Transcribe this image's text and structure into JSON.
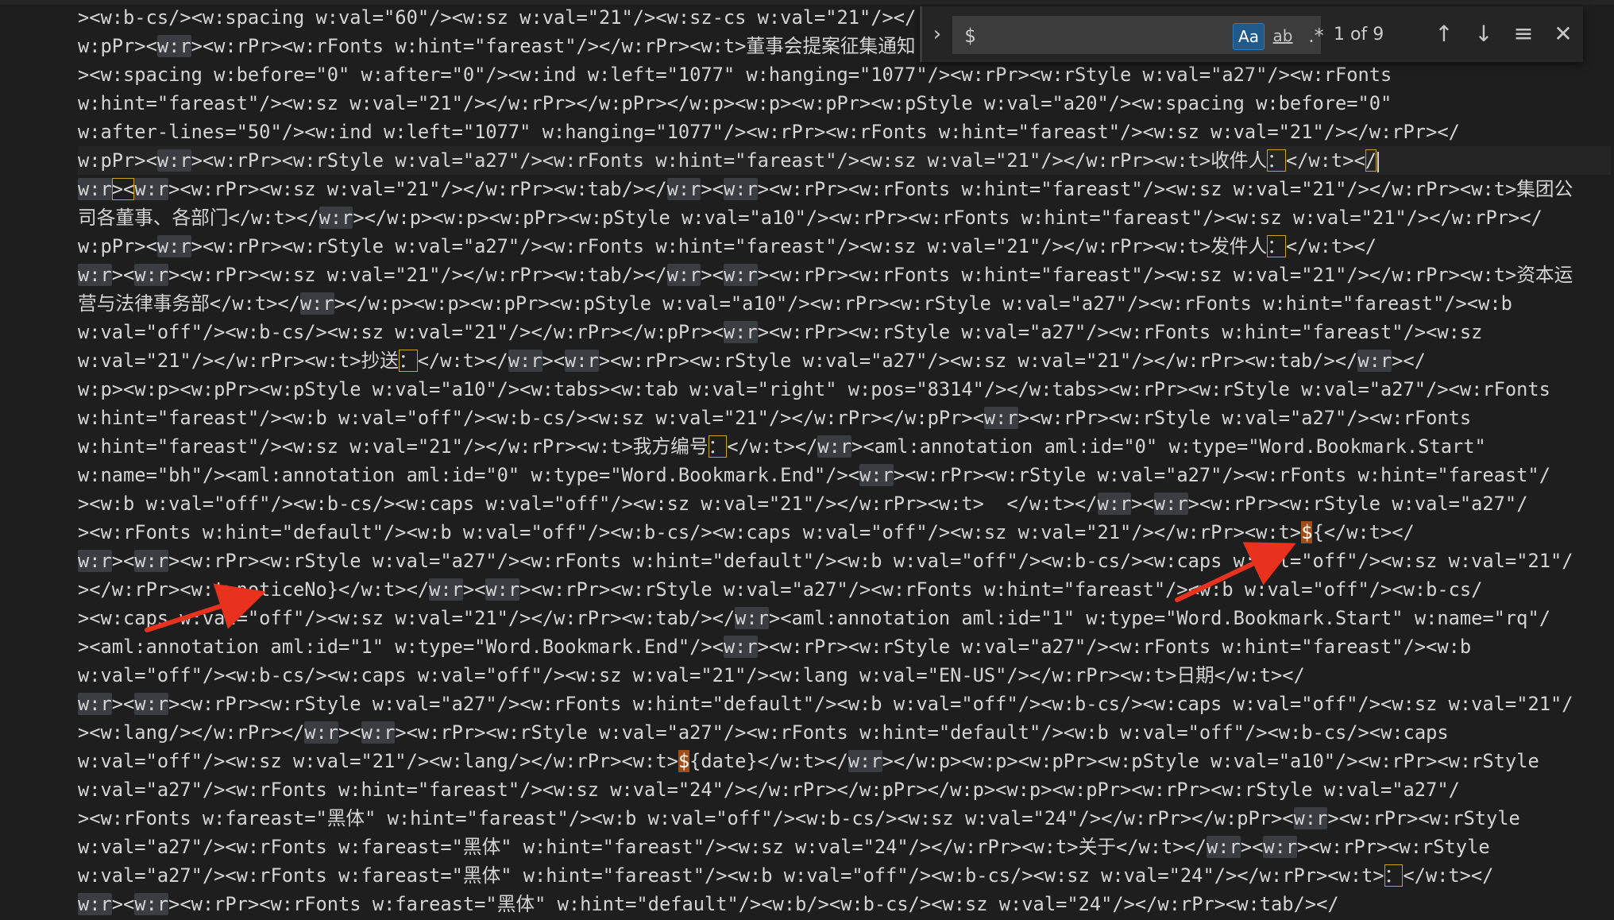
{
  "editor": {
    "lines": [
      [
        [
          "><w:b-cs/><w:spacing w:val=\"60\"/><w:sz w:val=\"21\"/><w:sz-cs w:val=\"21\"/></"
        ]
      ],
      [
        [
          "w:pPr><"
        ],
        [
          "w:r",
          "hl"
        ],
        [
          "><w:rPr><w:rFonts w:hint=\"fareast\"/></w:rPr><w:t>董事会提案征集通知"
        ]
      ],
      [
        [
          "><w:spacing w:before=\"0\" w:after=\"0\"/><w:ind w:left=\"1077\" w:hanging=\"1077\"/><w:rPr><w:rStyle w:val=\"a27\"/><w:rFonts"
        ]
      ],
      [
        [
          "w:hint=\"fareast\"/><w:sz w:val=\"21\"/></w:rPr></w:pPr></w:p><w:p><w:pPr><w:pStyle w:val=\"a20\"/><w:spacing w:before=\"0\""
        ]
      ],
      [
        [
          "w:after-lines=\"50\"/><w:ind w:left=\"1077\" w:hanging=\"1077\"/><w:rPr><w:rFonts w:hint=\"fareast\"/><w:sz w:val=\"21\"/></w:rPr></"
        ]
      ],
      [
        [
          "w:pPr><"
        ],
        [
          "w:r",
          "hl"
        ],
        [
          "><w:rPr><w:rStyle w:val=\"a27\"/><w:rFonts w:hint=\"fareast\"/><w:sz w:val=\"21\"/></w:rPr><w:t>收件人"
        ],
        [
          "：",
          "box"
        ],
        [
          "</w:t><"
        ],
        [
          "/",
          "box"
        ],
        [
          "",
          "caret"
        ]
      ],
      [
        [
          "w:r",
          "hl"
        ],
        [
          "><",
          "box"
        ],
        [
          "w:r",
          "hl"
        ],
        [
          "><w:rPr><w:sz w:val=\"21\"/></w:rPr><w:tab/></"
        ],
        [
          "w:r",
          "hl"
        ],
        [
          "><"
        ],
        [
          "w:r",
          "hl"
        ],
        [
          "><w:rPr><w:rFonts w:hint=\"fareast\"/><w:sz w:val=\"21\"/></w:rPr><w:t>集团公"
        ]
      ],
      [
        [
          "司各董事、各部门</w:t></"
        ],
        [
          "w:r",
          "hl"
        ],
        [
          "></w:p><w:p><w:pPr><w:pStyle w:val=\"a10\"/><w:rPr><w:rFonts w:hint=\"fareast\"/><w:sz w:val=\"21\"/></w:rPr></"
        ]
      ],
      [
        [
          "w:pPr><"
        ],
        [
          "w:r",
          "hl"
        ],
        [
          "><w:rPr><w:rStyle w:val=\"a27\"/><w:rFonts w:hint=\"fareast\"/><w:sz w:val=\"21\"/></w:rPr><w:t>发件人"
        ],
        [
          "：",
          "box"
        ],
        [
          "</w:t></"
        ]
      ],
      [
        [
          "w:r",
          "hl"
        ],
        [
          "><"
        ],
        [
          "w:r",
          "hl"
        ],
        [
          "><w:rPr><w:sz w:val=\"21\"/></w:rPr><w:tab/></"
        ],
        [
          "w:r",
          "hl"
        ],
        [
          "><"
        ],
        [
          "w:r",
          "hl"
        ],
        [
          "><w:rPr><w:rFonts w:hint=\"fareast\"/><w:sz w:val=\"21\"/></w:rPr><w:t>资本运"
        ]
      ],
      [
        [
          "营与法律事务部</w:t></"
        ],
        [
          "w:r",
          "hl"
        ],
        [
          "></w:p><w:p><w:pPr><w:pStyle w:val=\"a10\"/><w:rPr><w:rStyle w:val=\"a27\"/><w:rFonts w:hint=\"fareast\"/><w:b"
        ]
      ],
      [
        [
          "w:val=\"off\"/><w:b-cs/><w:sz w:val=\"21\"/></w:rPr></w:pPr><"
        ],
        [
          "w:r",
          "hl"
        ],
        [
          "><w:rPr><w:rStyle w:val=\"a27\"/><w:rFonts w:hint=\"fareast\"/><w:sz"
        ]
      ],
      [
        [
          "w:val=\"21\"/></w:rPr><w:t>抄送"
        ],
        [
          "：",
          "box"
        ],
        [
          "</w:t></"
        ],
        [
          "w:r",
          "hl"
        ],
        [
          "><"
        ],
        [
          "w:r",
          "hl"
        ],
        [
          "><w:rPr><w:rStyle w:val=\"a27\"/><w:sz w:val=\"21\"/></w:rPr><w:tab/></"
        ],
        [
          "w:r",
          "hl"
        ],
        [
          "></"
        ]
      ],
      [
        [
          "w:p><w:p><w:pPr><w:pStyle w:val=\"a10\"/><w:tabs><w:tab w:val=\"right\" w:pos=\"8314\"/></w:tabs><w:rPr><w:rStyle w:val=\"a27\"/><w:rFonts"
        ]
      ],
      [
        [
          "w:hint=\"fareast\"/><w:b w:val=\"off\"/><w:b-cs/><w:sz w:val=\"21\"/></w:rPr></w:pPr><"
        ],
        [
          "w:r",
          "hl"
        ],
        [
          "><w:rPr><w:rStyle w:val=\"a27\"/><w:rFonts"
        ]
      ],
      [
        [
          "w:hint=\"fareast\"/><w:sz w:val=\"21\"/></w:rPr><w:t>我方编号"
        ],
        [
          "：",
          "box"
        ],
        [
          "</w:t></"
        ],
        [
          "w:r",
          "hl"
        ],
        [
          "><aml:annotation aml:id=\"0\" w:type=\"Word.Bookmark.Start\""
        ]
      ],
      [
        [
          "w:name=\"bh\"/><aml:annotation aml:id=\"0\" w:type=\"Word.Bookmark.End\"/><"
        ],
        [
          "w:r",
          "hl"
        ],
        [
          "><w:rPr><w:rStyle w:val=\"a27\"/><w:rFonts w:hint=\"fareast\"/"
        ]
      ],
      [
        [
          "><w:b w:val=\"off\"/><w:b-cs/><w:caps w:val=\"off\"/><w:sz w:val=\"21\"/></w:rPr><w:t>  </w:t></"
        ],
        [
          "w:r",
          "hl"
        ],
        [
          "><"
        ],
        [
          "w:r",
          "hl"
        ],
        [
          "><w:rPr><w:rStyle w:val=\"a27\"/"
        ]
      ],
      [
        [
          "><w:rFonts w:hint=\"default\"/><w:b w:val=\"off\"/><w:b-cs/><w:caps w:val=\"off\"/><w:sz w:val=\"21\"/></w:rPr><w:t>"
        ],
        [
          "$",
          "cur"
        ],
        [
          "{</w:t></"
        ]
      ],
      [
        [
          "w:r",
          "hl"
        ],
        [
          "><"
        ],
        [
          "w:r",
          "hl"
        ],
        [
          "><w:rPr><w:rStyle w:val=\"a27\"/><w:rFonts w:hint=\"default\"/><w:b w:val=\"off\"/><w:b-cs/><w:caps w:val=\"off\"/><w:sz w:val=\"21\"/"
        ]
      ],
      [
        [
          "></w:rPr><w:t>noticeNo}</w:t></"
        ],
        [
          "w:r",
          "hl"
        ],
        [
          "><"
        ],
        [
          "w:r",
          "hl"
        ],
        [
          "><w:rPr><w:rStyle w:val=\"a27\"/><w:rFonts w:hint=\"fareast\"/><w:b w:val=\"off\"/><w:b-cs/"
        ]
      ],
      [
        [
          "><w:caps w:val=\"off\"/><w:sz w:val=\"21\"/></w:rPr><w:tab/></"
        ],
        [
          "w:r",
          "hl"
        ],
        [
          "><aml:annotation aml:id=\"1\" w:type=\"Word.Bookmark.Start\" w:name=\"rq\"/"
        ]
      ],
      [
        [
          "><aml:annotation aml:id=\"1\" w:type=\"Word.Bookmark.End\"/><"
        ],
        [
          "w:r",
          "hl"
        ],
        [
          "><w:rPr><w:rStyle w:val=\"a27\"/><w:rFonts w:hint=\"fareast\"/><w:b"
        ]
      ],
      [
        [
          "w:val=\"off\"/><w:b-cs/><w:caps w:val=\"off\"/><w:sz w:val=\"21\"/><w:lang w:val=\"EN-US\"/></w:rPr><w:t>日期</w:t></"
        ]
      ],
      [
        [
          "w:r",
          "hl"
        ],
        [
          "><"
        ],
        [
          "w:r",
          "hl"
        ],
        [
          "><w:rPr><w:rStyle w:val=\"a27\"/><w:rFonts w:hint=\"default\"/><w:b w:val=\"off\"/><w:b-cs/><w:caps w:val=\"off\"/><w:sz w:val=\"21\"/"
        ]
      ],
      [
        [
          "><w:lang/></w:rPr></"
        ],
        [
          "w:r",
          "hl"
        ],
        [
          "><"
        ],
        [
          "w:r",
          "hl"
        ],
        [
          "><w:rPr><w:rStyle w:val=\"a27\"/><w:rFonts w:hint=\"default\"/><w:b w:val=\"off\"/><w:b-cs/><w:caps"
        ]
      ],
      [
        [
          "w:val=\"off\"/><w:sz w:val=\"21\"/><w:lang/></w:rPr><w:t>"
        ],
        [
          "$",
          "cur"
        ],
        [
          "{date}</w:t></"
        ],
        [
          "w:r",
          "hl"
        ],
        [
          "></w:p><w:p><w:pPr><w:pStyle w:val=\"a10\"/><w:rPr><w:rStyle"
        ]
      ],
      [
        [
          "w:val=\"a27\"/><w:rFonts w:hint=\"fareast\"/><w:sz w:val=\"24\"/></w:rPr></w:pPr></w:p><w:p><w:pPr><w:rPr><w:rStyle w:val=\"a27\"/"
        ]
      ],
      [
        [
          "><w:rFonts w:fareast=\"黑体\" w:hint=\"fareast\"/><w:b w:val=\"off\"/><w:b-cs/><w:sz w:val=\"24\"/></w:rPr></w:pPr><"
        ],
        [
          "w:r",
          "hl"
        ],
        [
          "><w:rPr><w:rStyle"
        ]
      ],
      [
        [
          "w:val=\"a27\"/><w:rFonts w:fareast=\"黑体\" w:hint=\"fareast\"/><w:sz w:val=\"24\"/></w:rPr><w:t>关于</w:t></"
        ],
        [
          "w:r",
          "hl"
        ],
        [
          "><"
        ],
        [
          "w:r",
          "hl"
        ],
        [
          "><w:rPr><w:rStyle"
        ]
      ],
      [
        [
          "w:val=\"a27\"/><w:rFonts w:fareast=\"黑体\" w:hint=\"fareast\"/><w:b w:val=\"off\"/><w:b-cs/><w:sz w:val=\"24\"/></w:rPr><w:t>"
        ],
        [
          "：",
          "box"
        ],
        [
          "</w:t></"
        ]
      ],
      [
        [
          "w:r",
          "hl"
        ],
        [
          "><"
        ],
        [
          "w:r",
          "hl"
        ],
        [
          "><w:rPr><w:rFonts w:fareast=\"黑体\" w:hint=\"default\"/><w:b/><w:b-cs/><w:sz w:val=\"24\"/></w:rPr><w:tab/></"
        ]
      ]
    ]
  },
  "find": {
    "toggle_icon": "chevron-right-icon",
    "query": "$",
    "match_case_label": "Aa",
    "whole_word_label": "ab",
    "regex_label": ".*",
    "match_count": "1 of 9",
    "prev_icon": "arrow-up-icon",
    "next_icon": "arrow-down-icon",
    "selection_icon": "find-in-selection-icon",
    "close_icon": "close-icon"
  },
  "colors": {
    "background": "#1e1e1e",
    "text": "#d4d4d4",
    "selection_highlight": "#3a3d41",
    "match_border": "#c9a227",
    "current_match": "#a04f19",
    "annotation_arrow": "#e8321e",
    "toggle_active": "#1f5a8a"
  }
}
